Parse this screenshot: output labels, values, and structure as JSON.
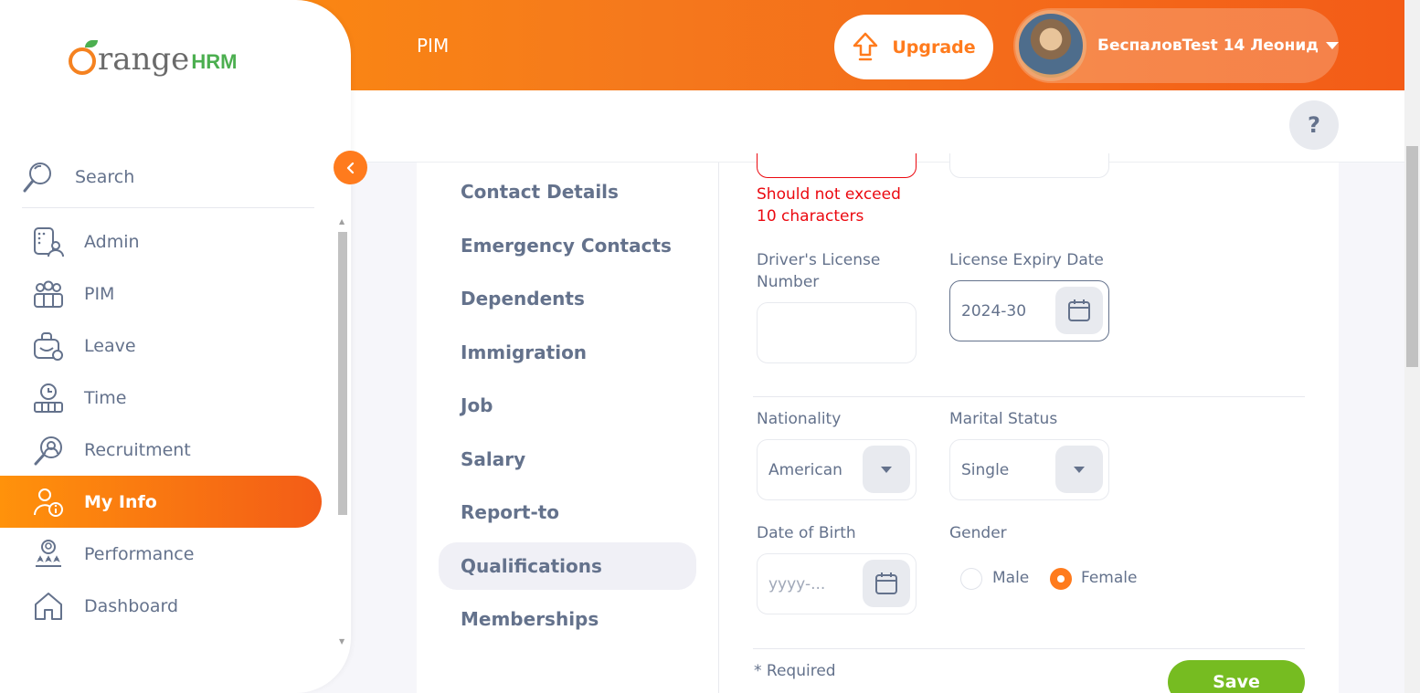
{
  "header": {
    "module_title": "PIM",
    "upgrade_label": "Upgrade",
    "user_name": "БеспаловTest 14 Леонид",
    "help_label": "?"
  },
  "sidebar": {
    "search_label": "Search",
    "items": [
      {
        "label": "Admin",
        "icon": "admin-icon"
      },
      {
        "label": "PIM",
        "icon": "pim-icon"
      },
      {
        "label": "Leave",
        "icon": "leave-icon"
      },
      {
        "label": "Time",
        "icon": "time-icon"
      },
      {
        "label": "Recruitment",
        "icon": "recruitment-icon"
      },
      {
        "label": "My Info",
        "icon": "my-info-icon",
        "active": true
      },
      {
        "label": "Performance",
        "icon": "performance-icon"
      },
      {
        "label": "Dashboard",
        "icon": "dashboard-icon"
      }
    ]
  },
  "tabs": [
    "Contact Details",
    "Emergency Contacts",
    "Dependents",
    "Immigration",
    "Job",
    "Salary",
    "Report-to",
    "Qualifications",
    "Memberships"
  ],
  "form": {
    "error_text_line1": "Should not exceed",
    "error_text_line2": "10 characters",
    "drivers_license_label_line1": "Driver's License",
    "drivers_license_label_line2": "Number",
    "drivers_license_value": "",
    "license_expiry_label": "License Expiry Date",
    "license_expiry_value": "2024-30",
    "nationality_label": "Nationality",
    "nationality_value": "American",
    "marital_status_label": "Marital Status",
    "marital_status_value": "Single",
    "dob_label": "Date of Birth",
    "dob_placeholder": "yyyy-...",
    "gender_label": "Gender",
    "gender_options": [
      "Male",
      "Female"
    ],
    "gender_selected": "Female",
    "required_note": "* Required",
    "save_label": "Save"
  },
  "colors": {
    "accent": "#ff7b1d",
    "error": "#eb0910",
    "save": "#76bc21"
  }
}
